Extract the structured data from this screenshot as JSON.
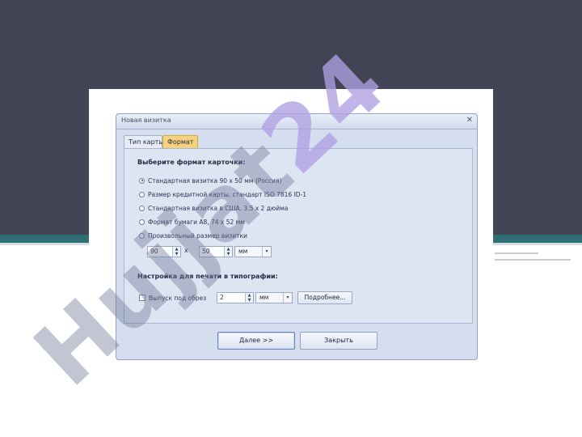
{
  "dialog": {
    "title": "Новая визитка",
    "close_glyph": "✕",
    "tabs": [
      {
        "label": "Тип карты",
        "active": false
      },
      {
        "label": "Формат",
        "active": true
      }
    ],
    "format_section_title": "Выберите формат карточки:",
    "options": [
      {
        "label": "Стандартная визитка 90 х 50 мм (Россия)",
        "selected": true
      },
      {
        "label": "Размер кредитной карты, стандарт ISO 7816 ID-1",
        "selected": false
      },
      {
        "label": "Стандартная визитка в США, 3.5 х 2 дюйма",
        "selected": false
      },
      {
        "label": "Формат бумаги A8, 74 х 52 мм",
        "selected": false
      },
      {
        "label": "Произвольный размер визитки",
        "selected": false
      }
    ],
    "custom_size": {
      "width": "90",
      "separator": "x",
      "height": "50",
      "unit": "мм"
    },
    "print_section_title": "Настройка для печати в типографии:",
    "bleed": {
      "label": "Выпуск под обрез",
      "checked": false,
      "value": "2",
      "unit": "мм",
      "details_label": "Подробнее..."
    },
    "next_label": "Далее >>",
    "close_label": "Закрыть"
  },
  "watermark": {
    "text_main": "Hujjat",
    "text_accent": "24"
  },
  "colors": {
    "slide_top": "#434356",
    "slide_band": "#2f6e73",
    "dialog_bg": "#d5deef",
    "active_tab": "#f7d27e"
  },
  "icons": {
    "spinner": "up-down-arrows",
    "combo": "chevron-down",
    "close": "close-x"
  }
}
